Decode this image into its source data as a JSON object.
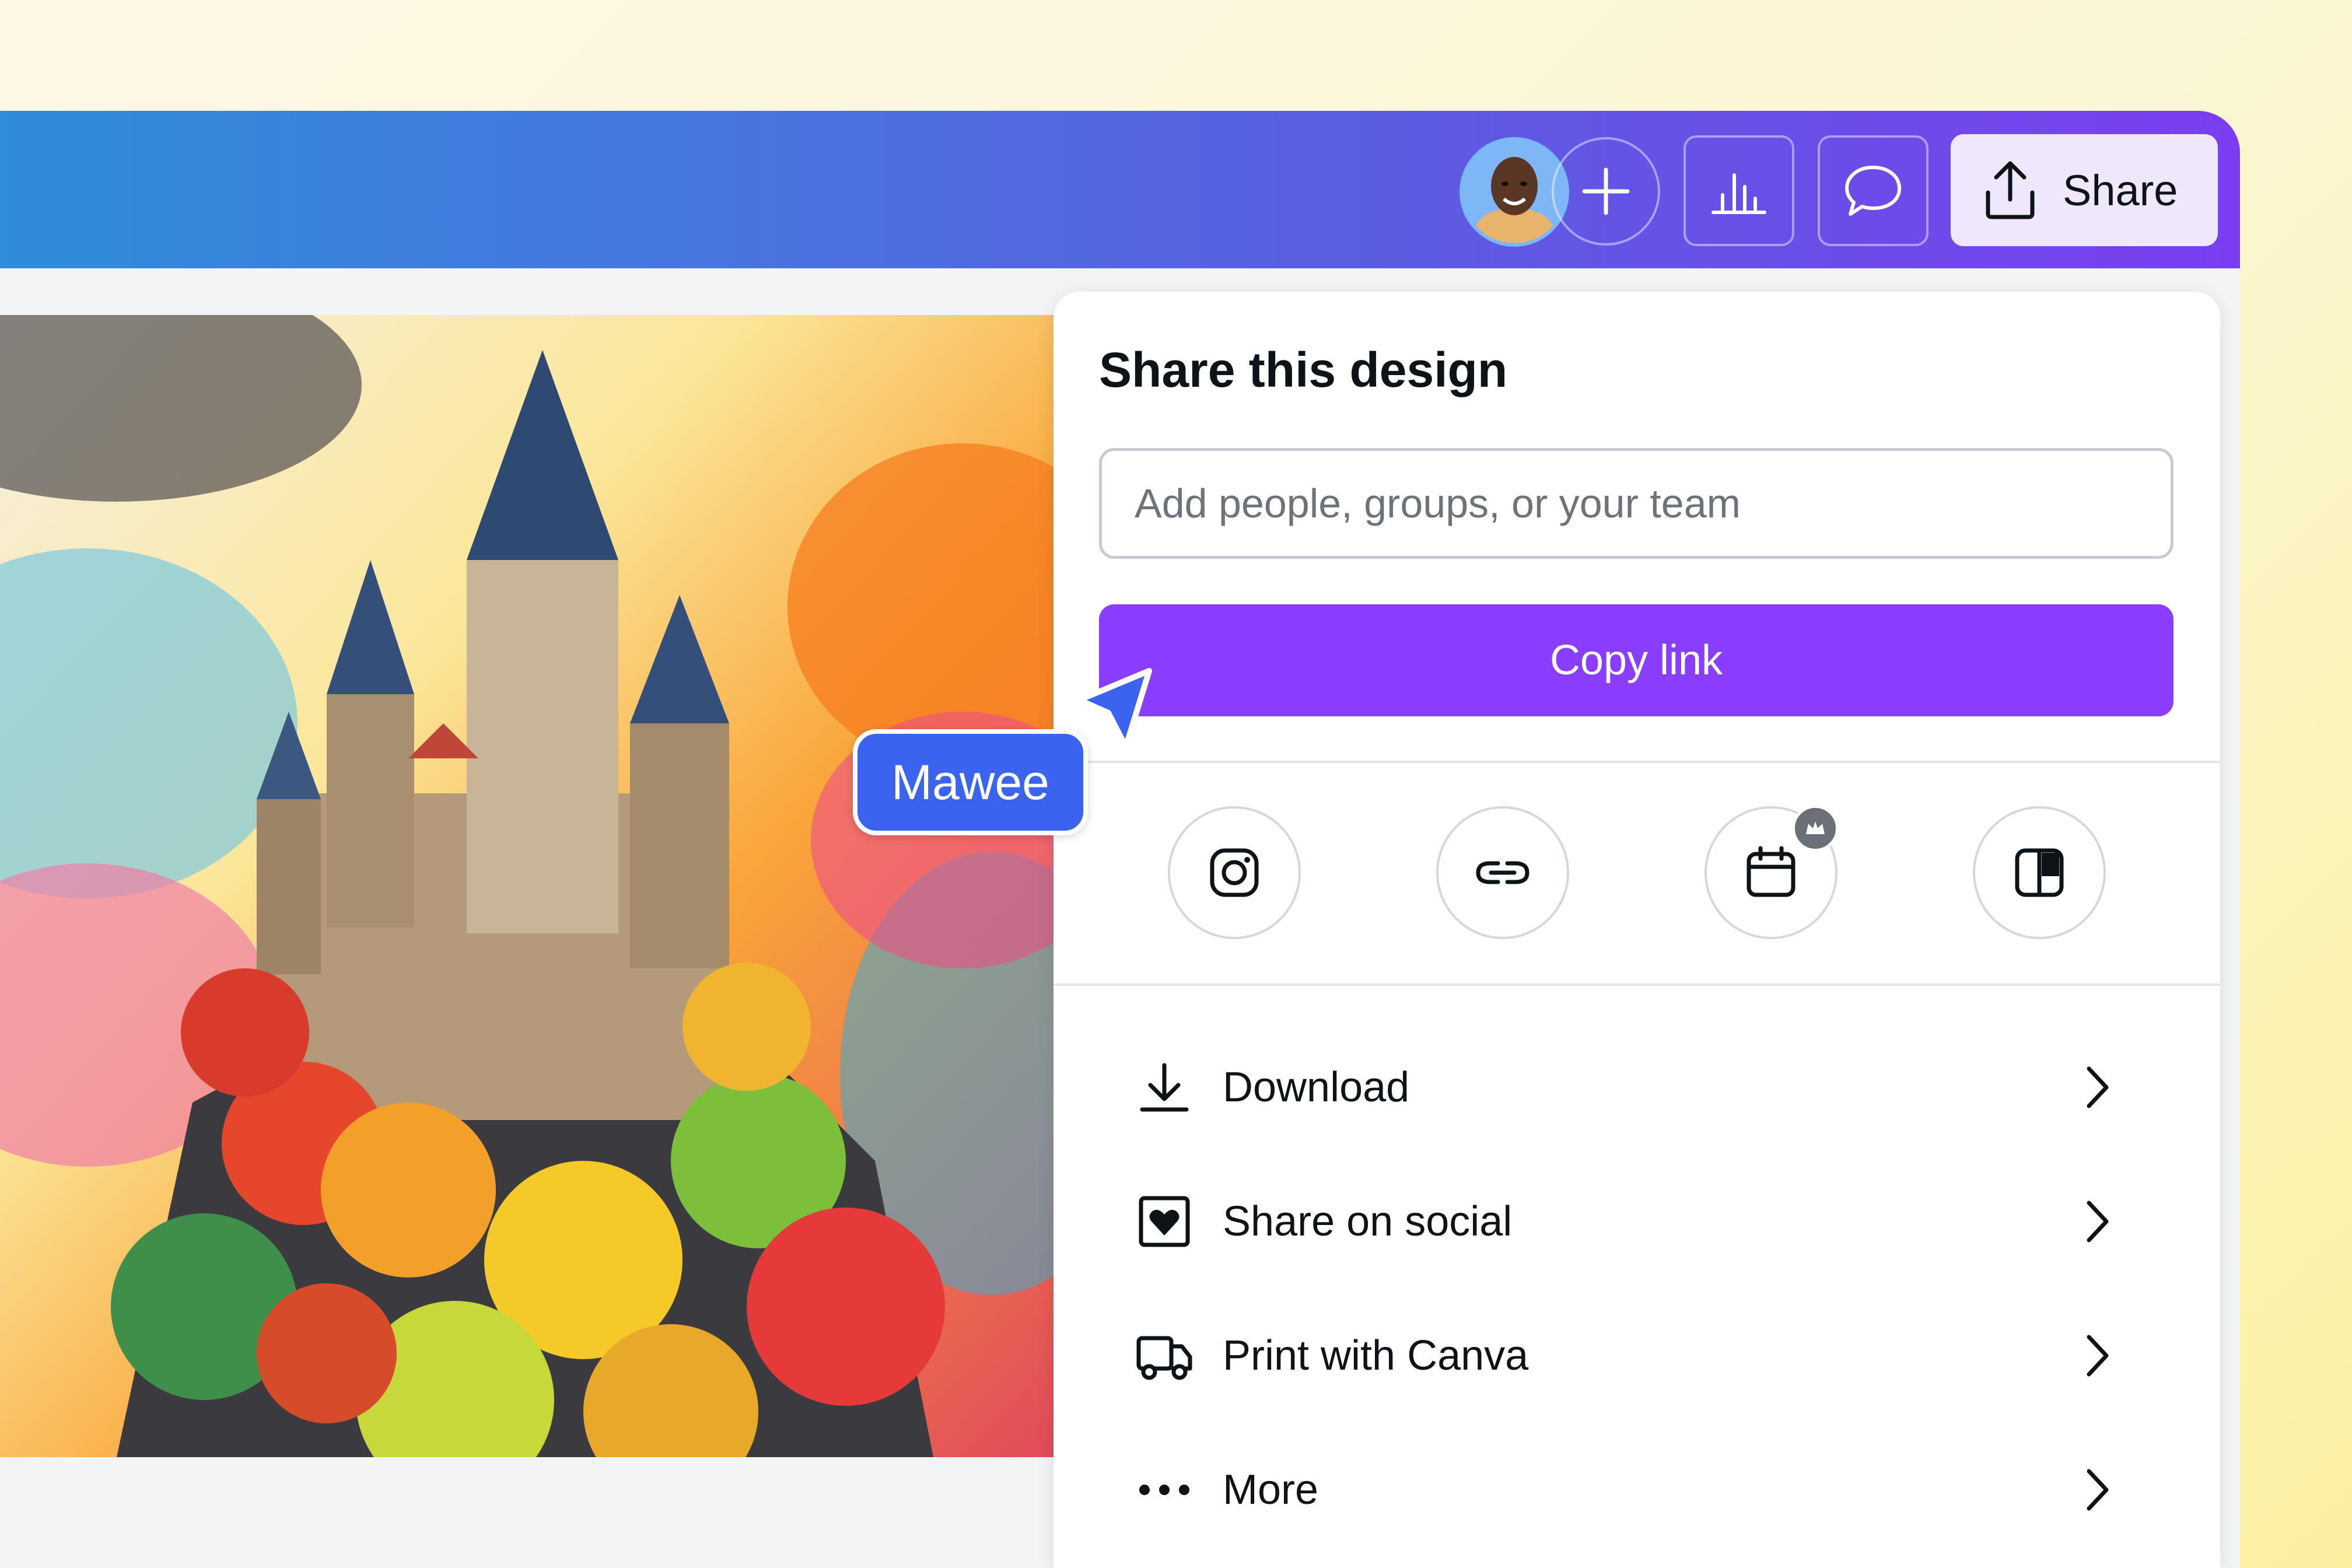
{
  "topbar": {
    "share_label": "Share",
    "buttons": [
      "avatar",
      "plus-icon",
      "insights-icon",
      "comment-icon",
      "share-upload-icon"
    ]
  },
  "share_panel": {
    "title": "Share this design",
    "input_placeholder": "Add people, groups, or your team",
    "copy_link_label": "Copy link",
    "quick_actions": [
      "instagram-icon",
      "link-icon",
      "schedule-calendar-icon",
      "embed-layout-icon"
    ],
    "menu": [
      {
        "label": "Download",
        "icon": "download-icon"
      },
      {
        "label": "Share on social",
        "icon": "heart-frame-icon"
      },
      {
        "label": "Print with Canva",
        "icon": "truck-icon"
      },
      {
        "label": "More",
        "icon": "more-dots-icon"
      }
    ]
  },
  "collaborator": {
    "name": "Mawee"
  },
  "colors": {
    "brand_purple": "#8b3dff",
    "cursor_blue": "#3a63f0"
  }
}
